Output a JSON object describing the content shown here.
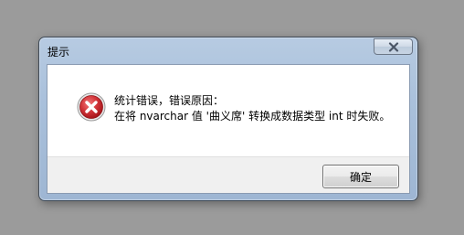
{
  "dialog": {
    "title": "提示",
    "message_line1": "统计错误，错误原因：",
    "message_line2": "在将 nvarchar 值 '曲义席' 转换成数据类型 int 时失败。",
    "ok_label": "确定",
    "icon": "error-icon"
  },
  "colors": {
    "error_red": "#c8262b",
    "background": "#9b9b9b"
  }
}
